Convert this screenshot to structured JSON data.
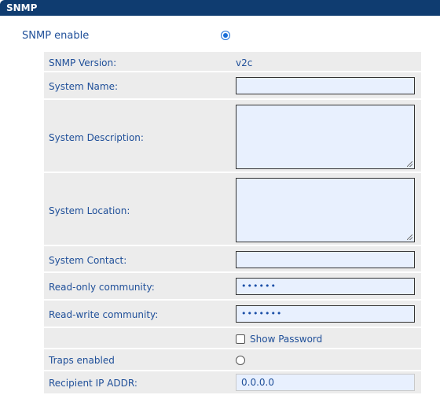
{
  "header": {
    "title": "SNMP"
  },
  "snmp_enable": {
    "label": "SNMP enable",
    "checked": true
  },
  "fields": {
    "version": {
      "label": "SNMP Version:",
      "value": "v2c"
    },
    "system_name": {
      "label": "System Name:",
      "value": ""
    },
    "system_description": {
      "label": "System Description:",
      "value": ""
    },
    "system_location": {
      "label": "System Location:",
      "value": ""
    },
    "system_contact": {
      "label": "System Contact:",
      "value": ""
    },
    "ro_community": {
      "label": "Read-only community:",
      "value": "••••••"
    },
    "rw_community": {
      "label": "Read-write community:",
      "value": "•••••••"
    },
    "show_password": {
      "label": "Show Password",
      "checked": false
    },
    "traps": {
      "label": "Traps enabled",
      "checked": false
    },
    "recipient_ip": {
      "label": "Recipient IP ADDR:",
      "value": "0.0.0.0"
    }
  }
}
